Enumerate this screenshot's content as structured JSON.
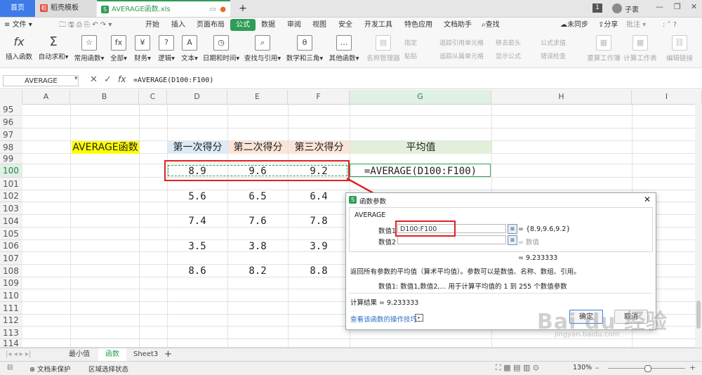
{
  "titlebar": {
    "home_tab": "首页",
    "doc_tab": "稻壳模板",
    "active_tab": "AVERAGE函数.xls",
    "new_tab": "+",
    "page_num": "1",
    "user": "子衷"
  },
  "menubar": {
    "file": "文件",
    "items": [
      "开始",
      "插入",
      "页面布局",
      "公式",
      "数据",
      "审阅",
      "视图",
      "安全",
      "开发工具",
      "特色应用",
      "文档助手",
      "查找"
    ],
    "sync": "未同步",
    "share": "分享",
    "comment": "批注"
  },
  "ribbon": {
    "buttons": [
      "插入函数",
      "自动求和",
      "常用函数",
      "全部",
      "财务",
      "逻辑",
      "文本",
      "日期和时间",
      "查找与引用",
      "数学和三角",
      "其他函数"
    ],
    "name_manager": "名称管理器",
    "specify": "指定",
    "paste": "粘贴",
    "trace_precedents": "追踪引用单元格",
    "trace_dependents": "追踪从属单元格",
    "remove_arrows": "移去箭头",
    "show_formulas": "显示公式",
    "eval_formula": "公式求值",
    "error_check": "错误检查",
    "recalc_workbook": "重算工作簿",
    "calc_sheet": "计算工作表",
    "edit_links": "编辑链接"
  },
  "formula_bar": {
    "name_box": "AVERAGE",
    "fx": "fx",
    "formula": "=AVERAGE(D100:F100)"
  },
  "columns": [
    "A",
    "B",
    "C",
    "D",
    "E",
    "F",
    "G",
    "H",
    "I"
  ],
  "rows": [
    "95",
    "96",
    "97",
    "98",
    "99",
    "100",
    "101",
    "102",
    "103",
    "104",
    "105",
    "106",
    "107",
    "108",
    "109",
    "110",
    "111",
    "112",
    "113",
    "114"
  ],
  "sheet": {
    "label_b98": "AVERAGE函数",
    "headers": [
      "第一次得分",
      "第二次得分",
      "第三次得分",
      "平均值"
    ],
    "row100": [
      "8.9",
      "9.6",
      "9.2"
    ],
    "g100": "=AVERAGE(D100:F100)",
    "row102": [
      "5.6",
      "6.5",
      "6.4"
    ],
    "row104": [
      "7.4",
      "7.6",
      "7.8"
    ],
    "row106": [
      "3.5",
      "3.8",
      "3.9"
    ],
    "row108": [
      "8.6",
      "8.2",
      "8.8"
    ]
  },
  "colors": {
    "accent": "#2e9d55",
    "yellow": "#ffff00",
    "header_blue": "#ddebf7",
    "header_orange": "#fce4d6",
    "header_green": "#e2efda",
    "red_box": "#e02020"
  },
  "dialog": {
    "title": "函数参数",
    "func_name": "AVERAGE",
    "arg1_label": "数值1",
    "arg1_value": "D100:F100",
    "arg1_result": "= {8.9,9.6,9.2}",
    "arg2_label": "数值2",
    "arg2_result": "= 数值",
    "total_result": "= 9.233333",
    "description": "返回所有参数的平均值（算术平均值）。参数可以是数值、名称、数组、引用。",
    "arg_help": "数值1:  数值1,数值2,... 用于计算平均值的 1 到 255 个数值参数",
    "calc_result": "计算结果 =  9.233333",
    "help_link": "查看该函数的操作技巧",
    "ok": "确定",
    "cancel": "取消"
  },
  "sheet_tabs": [
    "最小值",
    "函数",
    "Sheet3"
  ],
  "statusbar": {
    "protect": "文档未保护",
    "region": "区域选择状态",
    "zoom": "130%"
  },
  "watermark": {
    "brand": "Bai du 经验",
    "url": "jingyan.baidu.com"
  }
}
